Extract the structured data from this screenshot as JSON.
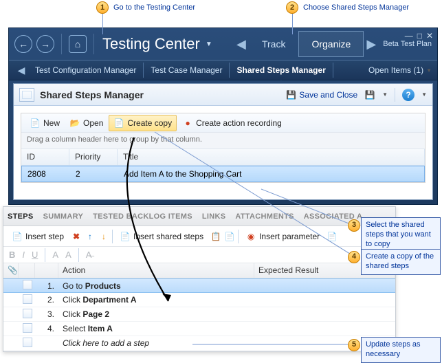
{
  "callouts": {
    "c1": "Go to the Testing Center",
    "c2": "Choose Shared Steps Manager",
    "c3": "Select the shared steps that you want to copy",
    "c4": "Create a copy of the shared steps",
    "c5": "Update steps as necessary"
  },
  "window": {
    "title": "Testing Center",
    "tabs": {
      "track": "Track",
      "organize": "Organize"
    },
    "plan": "Beta Test Plan",
    "subnav": {
      "a": "Test Configuration Manager",
      "b": "Test Case Manager",
      "c": "Shared Steps Manager",
      "open": "Open Items (1)"
    }
  },
  "content": {
    "heading": "Shared Steps Manager",
    "save": "Save and Close",
    "toolbar": {
      "new": "New",
      "open": "Open",
      "copy": "Create copy",
      "rec": "Create action recording"
    },
    "groupHint": "Drag a column header here to group by that column.",
    "cols": {
      "id": "ID",
      "pr": "Priority",
      "ti": "Title"
    },
    "row": {
      "id": "2808",
      "pr": "2",
      "ti": "Add Item A to the Shopping Cart"
    }
  },
  "steps": {
    "tabs": {
      "a": "STEPS",
      "b": "SUMMARY",
      "c": "TESTED BACKLOG ITEMS",
      "d": "LINKS",
      "e": "ATTACHMENTS",
      "f": "ASSOCIATED A..."
    },
    "tb": {
      "ins": "Insert step",
      "shared": "Insert shared steps",
      "param": "Insert parameter"
    },
    "cols": {
      "action": "Action",
      "exp": "Expected Result"
    },
    "rows": {
      "r1": {
        "n": "1.",
        "a_pre": "Go to ",
        "a_b": "Products"
      },
      "r2": {
        "n": "2.",
        "a_pre": "Click ",
        "a_b": "Department A"
      },
      "r3": {
        "n": "3.",
        "a_pre": "Click ",
        "a_b": "Page 2"
      },
      "r4": {
        "n": "4.",
        "a_pre": "Select ",
        "a_b": "Item A"
      },
      "add": "Click here to add a step"
    }
  }
}
